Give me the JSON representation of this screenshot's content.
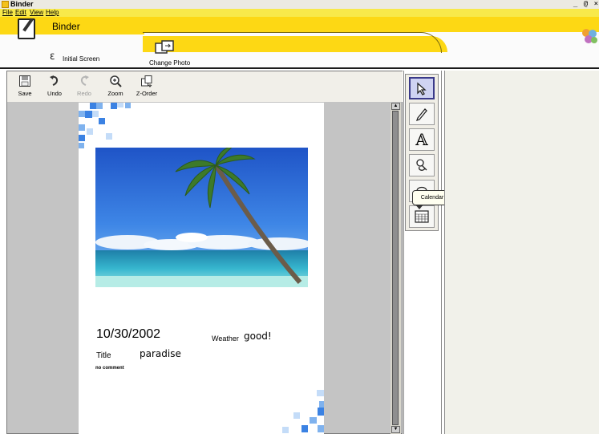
{
  "window": {
    "title": "Binder",
    "controls": "_ @ ×"
  },
  "menu": {
    "file": "File",
    "edit": "Edit",
    "view": "View",
    "help": "Help"
  },
  "header": {
    "tab_binder": "Binder",
    "initial_screen": "Initial Screen",
    "change_photo": "Change Photo"
  },
  "toolbar": {
    "save": "Save",
    "undo": "Undo",
    "redo": "Redo",
    "zoom": "Zoom",
    "z_order": "Z-Order"
  },
  "page": {
    "date": "10/30/2002",
    "weather_label": "Weather",
    "weather_value": "good!",
    "title_label": "Title",
    "title_value": "paradise",
    "comment": "no comment"
  },
  "tools": {
    "select": "select-arrow-icon",
    "pen": "pencil-icon",
    "text": "text-A-icon",
    "stamp": "stamp-icon",
    "sticker": "sticker-icon",
    "calendar": "calendar-icon"
  },
  "tooltip": {
    "text": "Calendar"
  },
  "colors": {
    "accent": "#fdd814",
    "menubar": "#f8e94a",
    "canvas": "#c4c4c4"
  }
}
